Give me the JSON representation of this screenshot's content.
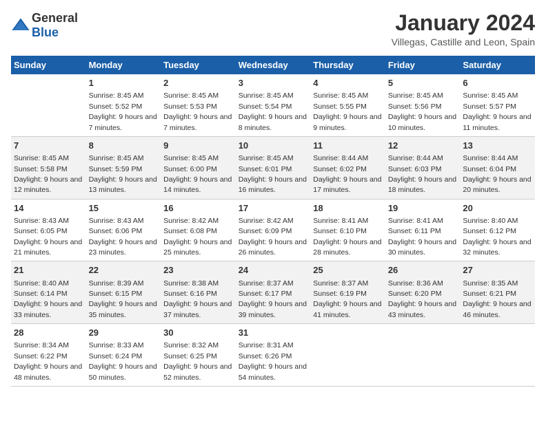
{
  "header": {
    "logo_general": "General",
    "logo_blue": "Blue",
    "title": "January 2024",
    "subtitle": "Villegas, Castille and Leon, Spain"
  },
  "days_of_week": [
    "Sunday",
    "Monday",
    "Tuesday",
    "Wednesday",
    "Thursday",
    "Friday",
    "Saturday"
  ],
  "weeks": [
    [
      {
        "day": "",
        "sunrise": "",
        "sunset": "",
        "daylight": ""
      },
      {
        "day": "1",
        "sunrise": "Sunrise: 8:45 AM",
        "sunset": "Sunset: 5:52 PM",
        "daylight": "Daylight: 9 hours and 7 minutes."
      },
      {
        "day": "2",
        "sunrise": "Sunrise: 8:45 AM",
        "sunset": "Sunset: 5:53 PM",
        "daylight": "Daylight: 9 hours and 7 minutes."
      },
      {
        "day": "3",
        "sunrise": "Sunrise: 8:45 AM",
        "sunset": "Sunset: 5:54 PM",
        "daylight": "Daylight: 9 hours and 8 minutes."
      },
      {
        "day": "4",
        "sunrise": "Sunrise: 8:45 AM",
        "sunset": "Sunset: 5:55 PM",
        "daylight": "Daylight: 9 hours and 9 minutes."
      },
      {
        "day": "5",
        "sunrise": "Sunrise: 8:45 AM",
        "sunset": "Sunset: 5:56 PM",
        "daylight": "Daylight: 9 hours and 10 minutes."
      },
      {
        "day": "6",
        "sunrise": "Sunrise: 8:45 AM",
        "sunset": "Sunset: 5:57 PM",
        "daylight": "Daylight: 9 hours and 11 minutes."
      }
    ],
    [
      {
        "day": "7",
        "sunrise": "Sunrise: 8:45 AM",
        "sunset": "Sunset: 5:58 PM",
        "daylight": "Daylight: 9 hours and 12 minutes."
      },
      {
        "day": "8",
        "sunrise": "Sunrise: 8:45 AM",
        "sunset": "Sunset: 5:59 PM",
        "daylight": "Daylight: 9 hours and 13 minutes."
      },
      {
        "day": "9",
        "sunrise": "Sunrise: 8:45 AM",
        "sunset": "Sunset: 6:00 PM",
        "daylight": "Daylight: 9 hours and 14 minutes."
      },
      {
        "day": "10",
        "sunrise": "Sunrise: 8:45 AM",
        "sunset": "Sunset: 6:01 PM",
        "daylight": "Daylight: 9 hours and 16 minutes."
      },
      {
        "day": "11",
        "sunrise": "Sunrise: 8:44 AM",
        "sunset": "Sunset: 6:02 PM",
        "daylight": "Daylight: 9 hours and 17 minutes."
      },
      {
        "day": "12",
        "sunrise": "Sunrise: 8:44 AM",
        "sunset": "Sunset: 6:03 PM",
        "daylight": "Daylight: 9 hours and 18 minutes."
      },
      {
        "day": "13",
        "sunrise": "Sunrise: 8:44 AM",
        "sunset": "Sunset: 6:04 PM",
        "daylight": "Daylight: 9 hours and 20 minutes."
      }
    ],
    [
      {
        "day": "14",
        "sunrise": "Sunrise: 8:43 AM",
        "sunset": "Sunset: 6:05 PM",
        "daylight": "Daylight: 9 hours and 21 minutes."
      },
      {
        "day": "15",
        "sunrise": "Sunrise: 8:43 AM",
        "sunset": "Sunset: 6:06 PM",
        "daylight": "Daylight: 9 hours and 23 minutes."
      },
      {
        "day": "16",
        "sunrise": "Sunrise: 8:42 AM",
        "sunset": "Sunset: 6:08 PM",
        "daylight": "Daylight: 9 hours and 25 minutes."
      },
      {
        "day": "17",
        "sunrise": "Sunrise: 8:42 AM",
        "sunset": "Sunset: 6:09 PM",
        "daylight": "Daylight: 9 hours and 26 minutes."
      },
      {
        "day": "18",
        "sunrise": "Sunrise: 8:41 AM",
        "sunset": "Sunset: 6:10 PM",
        "daylight": "Daylight: 9 hours and 28 minutes."
      },
      {
        "day": "19",
        "sunrise": "Sunrise: 8:41 AM",
        "sunset": "Sunset: 6:11 PM",
        "daylight": "Daylight: 9 hours and 30 minutes."
      },
      {
        "day": "20",
        "sunrise": "Sunrise: 8:40 AM",
        "sunset": "Sunset: 6:12 PM",
        "daylight": "Daylight: 9 hours and 32 minutes."
      }
    ],
    [
      {
        "day": "21",
        "sunrise": "Sunrise: 8:40 AM",
        "sunset": "Sunset: 6:14 PM",
        "daylight": "Daylight: 9 hours and 33 minutes."
      },
      {
        "day": "22",
        "sunrise": "Sunrise: 8:39 AM",
        "sunset": "Sunset: 6:15 PM",
        "daylight": "Daylight: 9 hours and 35 minutes."
      },
      {
        "day": "23",
        "sunrise": "Sunrise: 8:38 AM",
        "sunset": "Sunset: 6:16 PM",
        "daylight": "Daylight: 9 hours and 37 minutes."
      },
      {
        "day": "24",
        "sunrise": "Sunrise: 8:37 AM",
        "sunset": "Sunset: 6:17 PM",
        "daylight": "Daylight: 9 hours and 39 minutes."
      },
      {
        "day": "25",
        "sunrise": "Sunrise: 8:37 AM",
        "sunset": "Sunset: 6:19 PM",
        "daylight": "Daylight: 9 hours and 41 minutes."
      },
      {
        "day": "26",
        "sunrise": "Sunrise: 8:36 AM",
        "sunset": "Sunset: 6:20 PM",
        "daylight": "Daylight: 9 hours and 43 minutes."
      },
      {
        "day": "27",
        "sunrise": "Sunrise: 8:35 AM",
        "sunset": "Sunset: 6:21 PM",
        "daylight": "Daylight: 9 hours and 46 minutes."
      }
    ],
    [
      {
        "day": "28",
        "sunrise": "Sunrise: 8:34 AM",
        "sunset": "Sunset: 6:22 PM",
        "daylight": "Daylight: 9 hours and 48 minutes."
      },
      {
        "day": "29",
        "sunrise": "Sunrise: 8:33 AM",
        "sunset": "Sunset: 6:24 PM",
        "daylight": "Daylight: 9 hours and 50 minutes."
      },
      {
        "day": "30",
        "sunrise": "Sunrise: 8:32 AM",
        "sunset": "Sunset: 6:25 PM",
        "daylight": "Daylight: 9 hours and 52 minutes."
      },
      {
        "day": "31",
        "sunrise": "Sunrise: 8:31 AM",
        "sunset": "Sunset: 6:26 PM",
        "daylight": "Daylight: 9 hours and 54 minutes."
      },
      {
        "day": "",
        "sunrise": "",
        "sunset": "",
        "daylight": ""
      },
      {
        "day": "",
        "sunrise": "",
        "sunset": "",
        "daylight": ""
      },
      {
        "day": "",
        "sunrise": "",
        "sunset": "",
        "daylight": ""
      }
    ]
  ]
}
